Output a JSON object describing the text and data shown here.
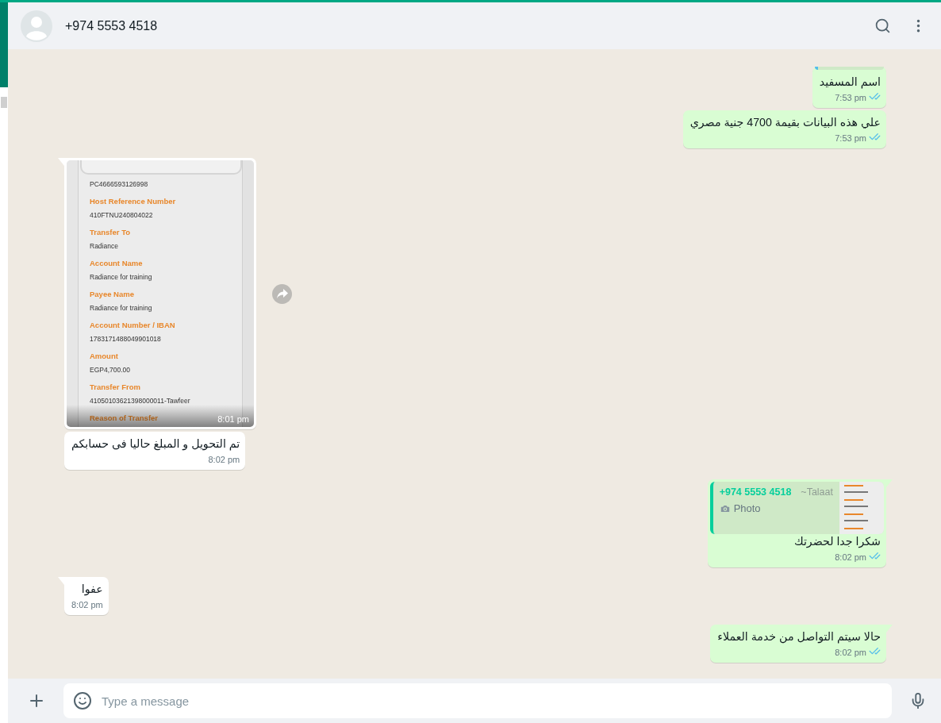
{
  "header": {
    "contact_name": "+974 5553 4518"
  },
  "messages": [
    {
      "kind": "text",
      "outgoing": true,
      "tail": false,
      "quoted": true,
      "text": "اسم المسفيد",
      "time": "7:53 pm",
      "read": true
    },
    {
      "kind": "text",
      "outgoing": true,
      "tail": false,
      "text": "علي هذه البيانات بقيمة 4700 جنية مصري",
      "time": "7:53 pm",
      "read": true
    },
    {
      "outgoing": false,
      "tail": true,
      "time": "8:01 pm",
      "receipt": {
        "first_value": "PC4666593126998",
        "fields": [
          {
            "label": "Host Reference Number",
            "value": "410FTNU240804022"
          },
          {
            "label": "Transfer To",
            "value": "Radiance"
          },
          {
            "label": "Account Name",
            "value": "Radiance for training"
          },
          {
            "label": "Payee Name",
            "value": "Radiance for training"
          },
          {
            "label": "Account Number / IBAN",
            "value": "1783171488049901018"
          },
          {
            "label": "Amount",
            "value": "EGP4,700.00"
          },
          {
            "label": "Transfer From",
            "value": "41050103621398000011-Tawfeer"
          },
          {
            "label": "Reason of Transfer"
          }
        ]
      }
    },
    {
      "kind": "text",
      "outgoing": false,
      "tail": false,
      "text": "تم التحويل و المبلغ حاليا فى حسابكم",
      "time": "8:02 pm"
    },
    {
      "kind": "reply",
      "outgoing": true,
      "tail": true,
      "reply": {
        "author": "+974 5553 4518",
        "author_name": "~Talaat",
        "type": "Photo"
      },
      "text": "شكرا جدا لحضرتك",
      "time": "8:02 pm",
      "read": true
    },
    {
      "kind": "text",
      "outgoing": false,
      "tail": true,
      "text": "عفوا",
      "time": "8:02 pm"
    },
    {
      "kind": "text",
      "outgoing": true,
      "tail": true,
      "text": "حالا سيتم التواصل من خدمة العملاء",
      "time": "8:02 pm",
      "read": true
    }
  ],
  "composer": {
    "placeholder": "Type a message"
  }
}
